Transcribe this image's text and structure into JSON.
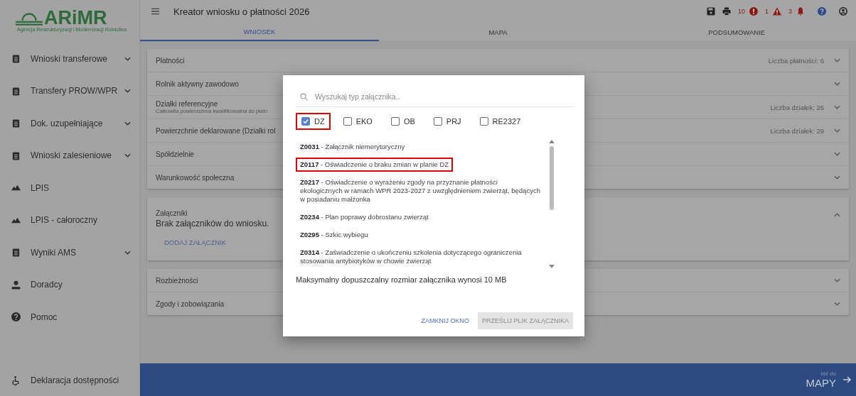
{
  "logo": {
    "name": "ARiMR",
    "subtitle": "Agencja Restrukturyzacji i Modernizacji Rolnictwa"
  },
  "sidebar": {
    "items": [
      {
        "label": "Wnioski transferowe",
        "kind": "document",
        "expandable": true
      },
      {
        "label": "Transfery PROW/WPR",
        "kind": "document",
        "expandable": true
      },
      {
        "label": "Dok. uzupełniające",
        "kind": "document",
        "expandable": true
      },
      {
        "label": "Wnioski zalesieniowe",
        "kind": "document",
        "expandable": true
      },
      {
        "label": "LPIS",
        "kind": "map",
        "expandable": false
      },
      {
        "label": "LPIS - całoroczny",
        "kind": "map",
        "expandable": false
      },
      {
        "label": "Wyniki AMS",
        "kind": "document",
        "expandable": true
      },
      {
        "label": "Doradcy",
        "kind": "person",
        "expandable": false
      },
      {
        "label": "Pomoc",
        "kind": "help",
        "expandable": false
      }
    ],
    "footer_item": {
      "label": "Deklaracja dostępności",
      "kind": "accessibility"
    }
  },
  "header": {
    "title": "Kreator wniosku o płatności 2026",
    "errors": "10",
    "warnings": "1",
    "notifications": "3"
  },
  "tabs": [
    {
      "label": "WNIOSEK",
      "selected": true
    },
    {
      "label": "MAPA",
      "selected": false
    },
    {
      "label": "PODSUMOWANIE",
      "selected": false
    }
  ],
  "sections": [
    {
      "rows": [
        {
          "title": "Płatności",
          "info": "Liczba płatności: 6",
          "expanded": false
        },
        {
          "title": "Rolnik aktywny zawodowo",
          "expanded": false
        },
        {
          "title": "Działki referencyjne",
          "subtitle": "Całkowita powierzchnia kwalifikowalna do płatn",
          "info": "Liczba działek: 26",
          "expanded": false
        },
        {
          "title": "Powierzchnie deklarowane (Działki rol",
          "info": "Liczba działek: 29",
          "expanded": false
        },
        {
          "title": "Spółdzielnie",
          "expanded": false
        },
        {
          "title": "Warunkowość społeczna",
          "expanded": false
        }
      ]
    },
    {
      "rows": [
        {
          "title": "Załączniki",
          "body": "Brak załączników do wniosku.",
          "action": "DODAJ ZAŁĄCZNIK",
          "expanded": true
        }
      ]
    },
    {
      "rows": [
        {
          "title": "Rozbieżności",
          "expanded": false
        },
        {
          "title": "Zgody i zobowiązania",
          "expanded": false
        }
      ]
    }
  ],
  "footer": {
    "small": "Idź do",
    "big": "MAPY"
  },
  "dialog": {
    "search": {
      "placeholder": "Wyszukaj typ załącznika.."
    },
    "filters": [
      {
        "label": "DZ",
        "checked": true,
        "highlighted": true
      },
      {
        "label": "EKO",
        "checked": false,
        "highlighted": false
      },
      {
        "label": "OB",
        "checked": false,
        "highlighted": false
      },
      {
        "label": "PRJ",
        "checked": false,
        "highlighted": false
      },
      {
        "label": "RE2327",
        "checked": false,
        "highlighted": false
      }
    ],
    "items": [
      {
        "text": "**Z0031** - Załącznik niemerytoryczny",
        "highlighted": false
      },
      {
        "text": "**Z0117** - Oświadczenie o braku zmian w planie DZ",
        "highlighted": true
      },
      {
        "text": "**Z0217** - Oświadczenie o wyrażeniu zgody na przyznanie płatności ekologicznych w ramach WPR 2023-2027 z uwzględnieniem zwierząt, będących w posiadaniu małżonka",
        "highlighted": false
      },
      {
        "text": "**Z0234** - Plan poprawy dobrostanu zwierząt",
        "highlighted": false
      },
      {
        "text": "**Z0295** - Szkic wybiegu",
        "highlighted": false
      },
      {
        "text": "**Z0314** - Zaświadczenie o ukończeniu szkolenia dotyczącego ograniczenia stosowania antybiotyków w chowie zwierząt",
        "highlighted": false
      }
    ],
    "note": "Maksymalny dopuszczalny rozmiar załącznika wynosi 10 MB",
    "buttons": [
      {
        "label": "ZAMKNIJ OKNO",
        "disabled": false
      },
      {
        "label": "PRZEŚLIJ PLIK ZAŁĄCZNIKA",
        "disabled": true
      }
    ]
  }
}
